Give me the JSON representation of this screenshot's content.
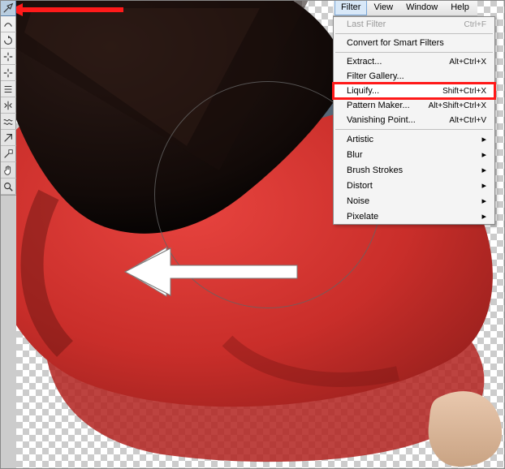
{
  "menubar": {
    "items": [
      "Filter",
      "View",
      "Window",
      "Help"
    ],
    "open_index": 0
  },
  "dropdown": {
    "last_filter": {
      "label": "Last Filter",
      "shortcut": "Ctrl+F"
    },
    "convert": {
      "label": "Convert for Smart Filters"
    },
    "extract": {
      "label": "Extract...",
      "shortcut": "Alt+Ctrl+X"
    },
    "filter_gallery": {
      "label": "Filter Gallery..."
    },
    "liquify": {
      "label": "Liquify...",
      "shortcut": "Shift+Ctrl+X"
    },
    "pattern_maker": {
      "label": "Pattern Maker...",
      "shortcut": "Alt+Shift+Ctrl+X"
    },
    "vanishing_point": {
      "label": "Vanishing Point...",
      "shortcut": "Alt+Ctrl+V"
    },
    "artistic": {
      "label": "Artistic"
    },
    "blur": {
      "label": "Blur"
    },
    "brush_strokes": {
      "label": "Brush Strokes"
    },
    "distort": {
      "label": "Distort"
    },
    "noise": {
      "label": "Noise"
    },
    "pixelate": {
      "label": "Pixelate"
    }
  },
  "toolbar": {
    "tools": [
      {
        "name": "forward-warp-tool",
        "active": true
      },
      {
        "name": "reconstruct-tool",
        "active": false
      },
      {
        "name": "twirl-clockwise-tool",
        "active": false
      },
      {
        "name": "pucker-tool",
        "active": false
      },
      {
        "name": "bloat-tool",
        "active": false
      },
      {
        "name": "push-left-tool",
        "active": false
      },
      {
        "name": "mirror-tool",
        "active": false
      },
      {
        "name": "turbulence-tool",
        "active": false
      },
      {
        "name": "freeze-mask-tool",
        "active": false
      },
      {
        "name": "thaw-mask-tool",
        "active": false
      },
      {
        "name": "hand-tool",
        "active": false
      },
      {
        "name": "zoom-tool",
        "active": false
      }
    ]
  },
  "accent": {
    "highlight_red": "#ff1a1a",
    "arrow_white": "#ffffff",
    "menubar_open_bg": "#d8e8f8"
  }
}
